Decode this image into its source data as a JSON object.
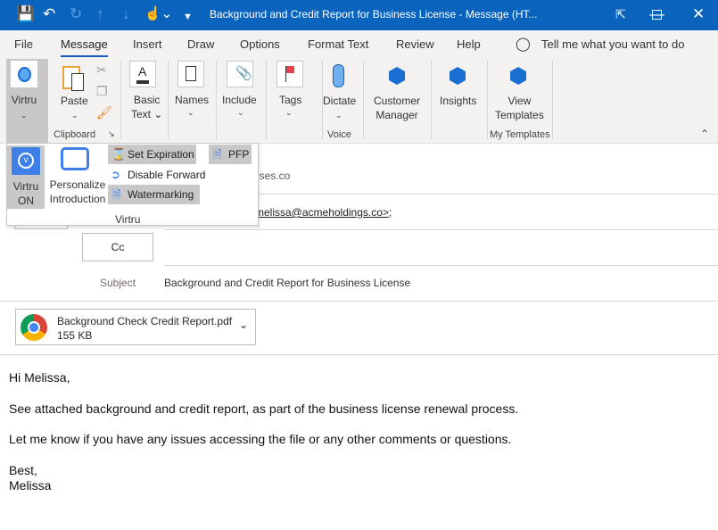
{
  "window": {
    "title": "Background and Credit Report for Business License  -  Message (HT...",
    "controls": [
      "restore-ribbon",
      "minimize",
      "maximize",
      "close"
    ]
  },
  "tabs": [
    "File",
    "Message",
    "Insert",
    "Draw",
    "Options",
    "Format Text",
    "Review",
    "Help"
  ],
  "active_tab": "Message",
  "tell_me": "Tell me what you want to do",
  "ribbon": {
    "virtru": "Virtru",
    "paste": "Paste",
    "clipboard": "Clipboard",
    "basic_text_1": "Basic",
    "basic_text_2": "Text",
    "names": "Names",
    "include": "Include",
    "tags": "Tags",
    "dictate": "Dictate",
    "voice": "Voice",
    "customer_1": "Customer",
    "customer_2": "Manager",
    "insights": "Insights",
    "view_1": "View",
    "view_2": "Templates",
    "my_templates": "My Templates"
  },
  "virtru_menu": {
    "virtru_on_1": "Virtru",
    "virtru_on_2": "ON",
    "personalize_1": "Personalize",
    "personalize_2": "Introduction",
    "set_expiration": "Set Expiration",
    "disable_forward": "Disable Forward",
    "watermarking": "Watermarking",
    "pfp": "PFP",
    "group": "Virtru"
  },
  "compose": {
    "from_partial": "rises.co",
    "to_partial": "melissa@acmeholdings.co>;",
    "cc": "Cc",
    "subject_label": "Subject",
    "subject": "Background and Credit Report for Business License"
  },
  "attachment": {
    "name": "Background Check  Credit Report.pdf",
    "size": "155 KB"
  },
  "body": [
    "Hi Melissa,",
    "See attached background and credit report, as part of the business license renewal process.",
    "Let me know if you have any issues accessing the file or any other comments or questions.",
    "Best,",
    "Melissa"
  ],
  "colors": {
    "titlebar": "#0a64be",
    "accent": "#185abd",
    "virtru_blue": "#3f7fe8"
  }
}
